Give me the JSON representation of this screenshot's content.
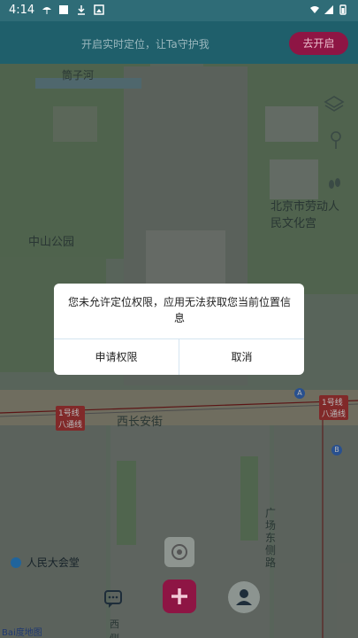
{
  "status": {
    "time": "4:14"
  },
  "banner": {
    "message": "开启实时定位，让Ta守护我",
    "button_label": "去开启"
  },
  "map": {
    "labels": {
      "road_north": "筒子河",
      "park": "中山公园",
      "palace": "北京市劳动人民文化宫",
      "street": "西长安街",
      "hall": "人民大会堂",
      "road_side": "广场东侧路",
      "metro_line_1": "1号线",
      "metro_bt": "八通线",
      "metro_line_1b": "1号线",
      "metro_bt_b": "八通线",
      "bottom_road": "西侧路",
      "logo": "Bai度地图"
    }
  },
  "dialog": {
    "message": "您未允许定位权限，应用无法获取您当前位置信息",
    "request_label": "申请权限",
    "cancel_label": "取消"
  },
  "icons": {
    "layers": "layers-icon",
    "pin": "pin-icon",
    "footprint": "footprint-icon",
    "locate": "locate-icon",
    "chat": "chat-icon",
    "add": "add-icon",
    "profile": "profile-icon"
  }
}
